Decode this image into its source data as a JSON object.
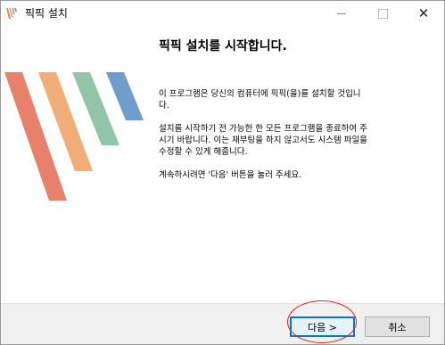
{
  "window": {
    "title": "픽픽 설치",
    "controls": {
      "minimize": "minimize-icon",
      "maximize": "maximize-icon",
      "close": "close-icon"
    },
    "close_glyph": "✕"
  },
  "content": {
    "heading": "픽픽 설치를 시작합니다.",
    "paragraphs": [
      "이 프로그램은 당신의 컴퓨터에 픽픽(을)를 설치할 것입니\n다.",
      "설치를 시작하기 전 가능한 한 모든 프로그램을 종료하여 주\n시기 바랍니다. 이는 재부팅을 하지 않고서도 시스템 파일을\n수정할 수 있게 해줍니다.",
      "계속하시려면 '다음' 버튼을 눌러 주세요."
    ],
    "logo_colors": [
      "#e8816a",
      "#f0ad78",
      "#92c4a9",
      "#6e9dcc"
    ]
  },
  "footer": {
    "next_label": "다음 >",
    "cancel_label": "취소"
  },
  "accent": {
    "focus_blue": "#0078d7",
    "annotation_red": "#e02020"
  }
}
